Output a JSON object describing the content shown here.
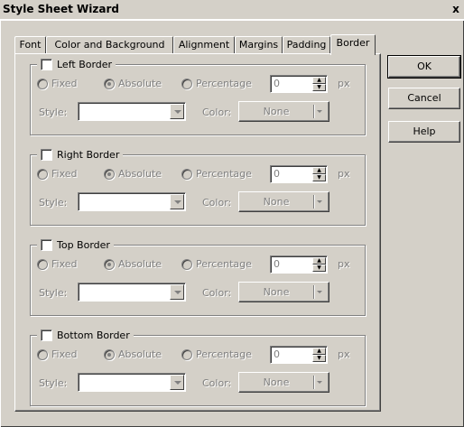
{
  "window": {
    "title": "Style Sheet Wizard",
    "close_glyph": "x"
  },
  "tabs": [
    {
      "label": "Font"
    },
    {
      "label": "Color and Background"
    },
    {
      "label": "Alignment"
    },
    {
      "label": "Margins"
    },
    {
      "label": "Padding"
    },
    {
      "label": "Border",
      "active": true
    }
  ],
  "groups": [
    {
      "title": "Left Border",
      "checked": false
    },
    {
      "title": "Right Border",
      "checked": false
    },
    {
      "title": "Top Border",
      "checked": false
    },
    {
      "title": "Bottom Border",
      "checked": false
    }
  ],
  "common": {
    "radio_fixed": "Fixed",
    "radio_absolute": "Absolute",
    "radio_percentage": "Percentage",
    "selected_mode": "Absolute",
    "width_value": "0",
    "unit": "px",
    "style_label": "Style:",
    "style_value": "",
    "color_label": "Color:",
    "color_value": "None"
  },
  "buttons": {
    "ok": "OK",
    "cancel": "Cancel",
    "help": "Help"
  },
  "colors": {
    "face": "#d4d0c8",
    "shadow": "#808080",
    "highlight": "#ffffff",
    "dark": "#404040"
  }
}
